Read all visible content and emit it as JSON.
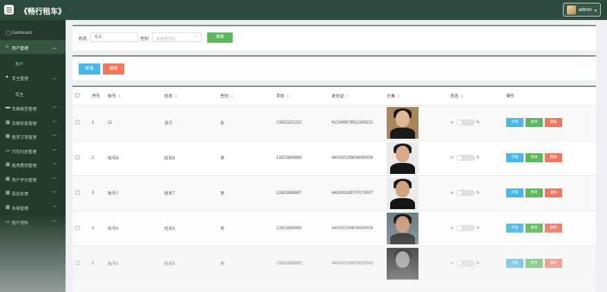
{
  "header": {
    "title": "《畅行租车》",
    "user": "admin"
  },
  "sidebar": {
    "items": [
      {
        "label": "Dashboard",
        "icon": "dashboard-icon",
        "glyph": "◯"
      },
      {
        "label": "用户管理",
        "icon": "home-icon",
        "glyph": "⌂",
        "chevron": "︿",
        "active": true,
        "sub": "用户"
      },
      {
        "label": "车主管理",
        "icon": "pin-icon",
        "glyph": "●",
        "chevron": "︿",
        "sub": "车主"
      },
      {
        "label": "车辆类型管理",
        "icon": "car-icon",
        "glyph": "▬",
        "chevron": "﹀"
      },
      {
        "label": "车辆信息管理",
        "icon": "grid-icon",
        "glyph": "▦",
        "chevron": "﹀"
      },
      {
        "label": "租赁订单管理",
        "icon": "grid-icon",
        "glyph": "▦",
        "chevron": "﹀"
      },
      {
        "label": "汽车归还管理",
        "icon": "card-icon",
        "glyph": "▭",
        "chevron": "﹀"
      },
      {
        "label": "租用费用管理",
        "icon": "grid-icon",
        "glyph": "▦",
        "chevron": "﹀"
      },
      {
        "label": "用户评分管理",
        "icon": "grid-icon",
        "glyph": "▦",
        "chevron": "﹀"
      },
      {
        "label": "投诉反馈",
        "icon": "grid-icon",
        "glyph": "▦",
        "chevron": "﹀"
      },
      {
        "label": "系统管理",
        "icon": "grid-icon",
        "glyph": "▦",
        "chevron": "﹀"
      },
      {
        "label": "用户资料",
        "icon": "doc-icon",
        "glyph": "▭",
        "chevron": "﹀"
      }
    ]
  },
  "search": {
    "name_label": "姓名",
    "name_placeholder": "姓名",
    "gender_label": "性别",
    "gender_placeholder": "请选择性别",
    "search_button": "搜索"
  },
  "actions": {
    "add": "新增",
    "delete": "删除"
  },
  "table": {
    "headers": [
      "序号",
      "账号",
      "姓名",
      "性别",
      "手机",
      "身份证",
      "头像",
      "状态",
      "操作"
    ],
    "row_actions": {
      "detail": "详情",
      "edit": "修改",
      "delete": "删除"
    },
    "rows": [
      {
        "no": "1",
        "account": "11",
        "name": "张三",
        "gender": "女",
        "phone": "13922222222",
        "id": "412345678912345222"
      },
      {
        "no": "2",
        "account": "账号8",
        "name": "姓名8",
        "gender": "男",
        "phone": "13823888888",
        "id": "440300199808080008"
      },
      {
        "no": "3",
        "account": "账号7",
        "name": "姓名7",
        "gender": "男",
        "phone": "13823888887",
        "id": "440300199707070007"
      },
      {
        "no": "4",
        "account": "账号6",
        "name": "姓名6",
        "gender": "男",
        "phone": "13823888886",
        "id": "440300199606060006"
      },
      {
        "no": "5",
        "account": "账号5",
        "name": "姓名5",
        "gender": "男",
        "phone": "13823888885",
        "id": "440300199505050005"
      }
    ]
  },
  "colors": {
    "topbar": "#2d4a3e",
    "sidebar": "#243a2e",
    "green": "#5cb85c",
    "blue": "#48b8e8",
    "red": "#f0775e"
  }
}
